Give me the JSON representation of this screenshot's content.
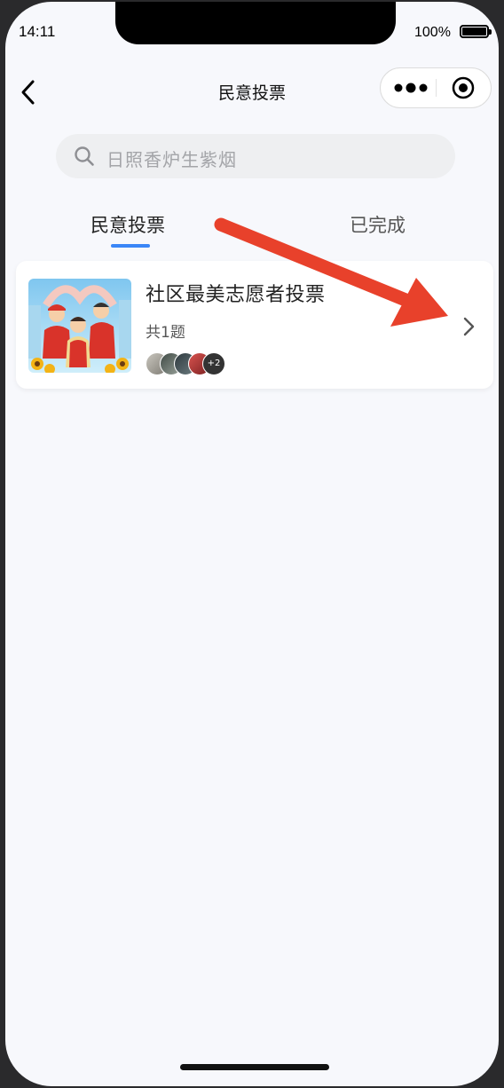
{
  "status_bar": {
    "time": "14:11",
    "battery_text": "100%",
    "battery_level": 1.0
  },
  "nav": {
    "title": "民意投票",
    "back_icon": "chevron-left-icon",
    "capsule_more_icon": "more-dots-icon",
    "capsule_close_icon": "target-close-icon"
  },
  "search": {
    "placeholder": "日照香炉生紫烟",
    "icon": "search-icon"
  },
  "tabs": [
    {
      "label": "民意投票",
      "active": true
    },
    {
      "label": "已完成",
      "active": false
    }
  ],
  "accent_color": "#3a86f7",
  "annotation_arrow_color": "#e8412b",
  "votes": [
    {
      "title": "社区最美志愿者投票",
      "count": "共1题",
      "extra_participants": "+2",
      "thumbnail": "volunteers-illustration"
    }
  ]
}
